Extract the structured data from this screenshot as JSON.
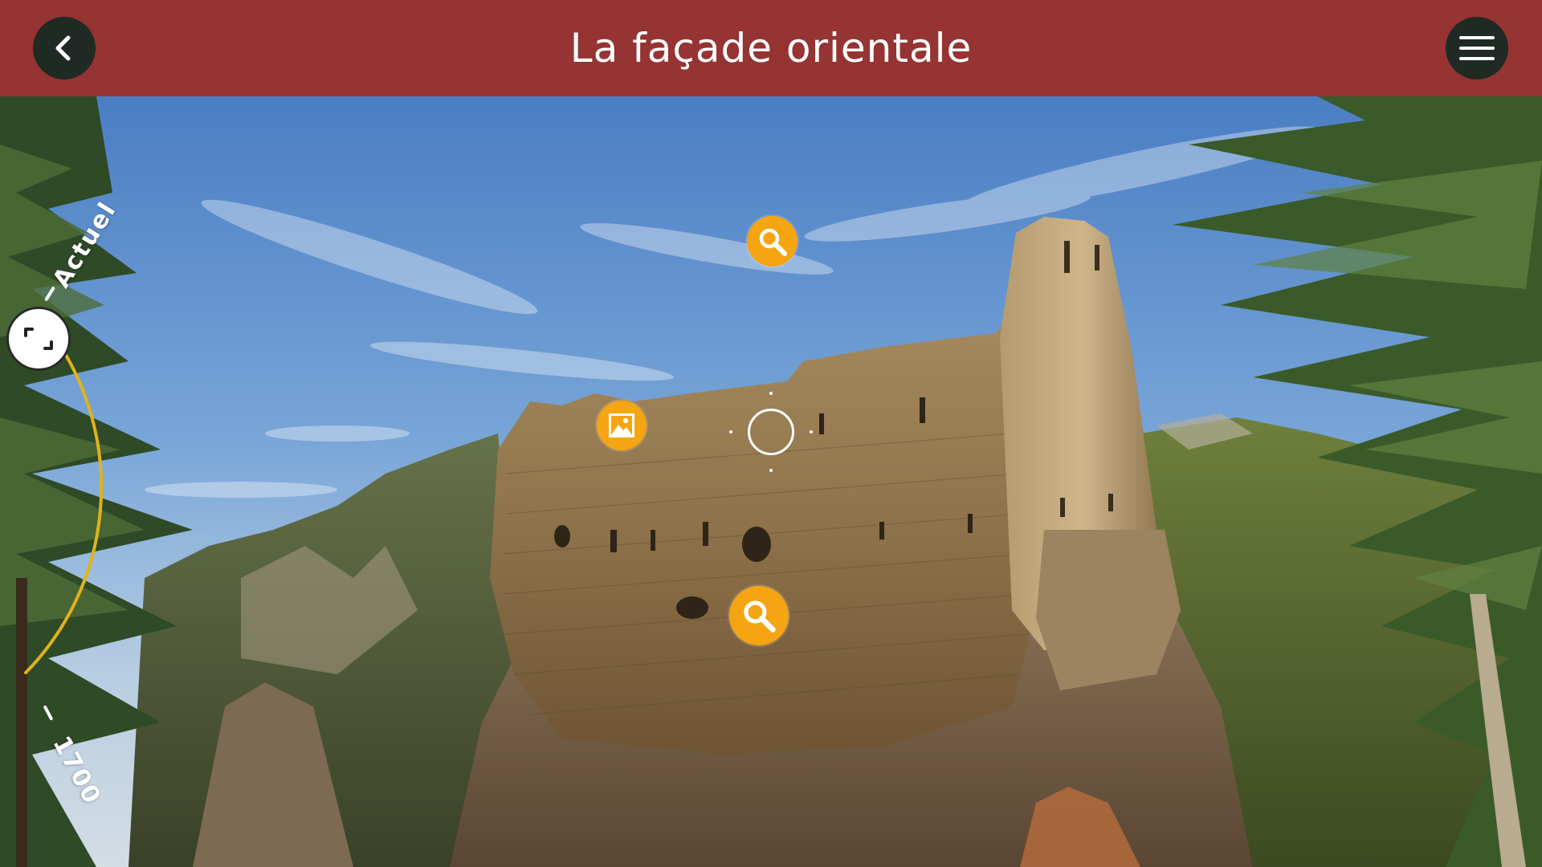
{
  "header": {
    "title": "La façade orientale",
    "back_icon": "chevron-left-icon",
    "menu_icon": "hamburger-menu-icon",
    "background_color": "#963333",
    "button_color": "#1f2a24"
  },
  "hotspots": [
    {
      "type": "zoom",
      "icon": "magnifier-icon"
    },
    {
      "type": "image",
      "icon": "picture-icon"
    },
    {
      "type": "zoom",
      "icon": "magnifier-icon"
    }
  ],
  "hotspot_color": "#f5a412",
  "timeline": {
    "top_label": "Actuel",
    "bottom_label": "1700",
    "track_color": "#e0b21c",
    "handle_icon": "expand-corners-icon"
  }
}
